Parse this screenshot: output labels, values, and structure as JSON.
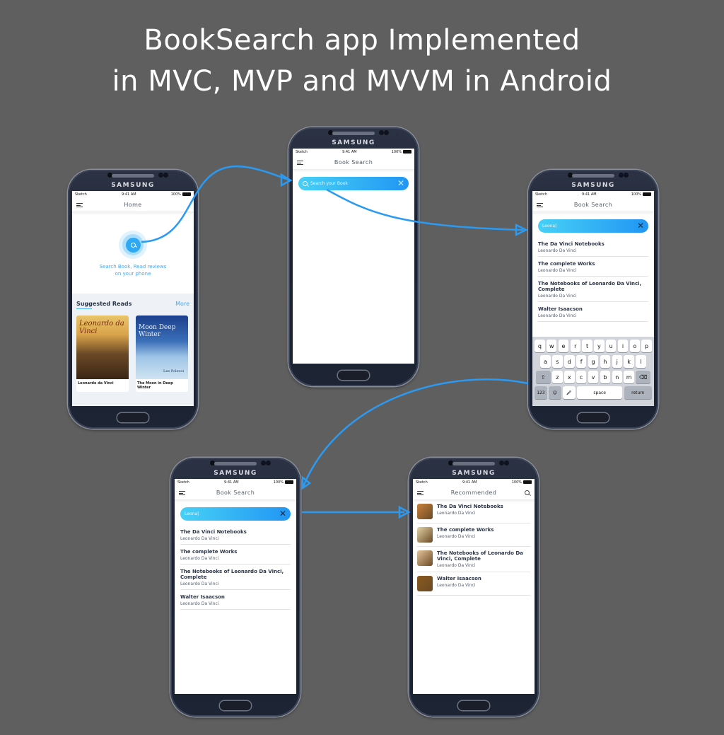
{
  "title_line1": "BookSearch app Implemented",
  "title_line2": "in MVC, MVP and MVVM in Android",
  "accent_color": "#2196f3",
  "phone_brand": "SAMSUNG",
  "status": {
    "carrier": "Sketch",
    "time": "9:41 AM",
    "battery": "100%"
  },
  "home": {
    "nav_title": "Home",
    "tagline_1": "Search Book, Read reviews",
    "tagline_2": "on your phone",
    "suggested_title": "Suggested Reads",
    "more_label": "More",
    "books": [
      {
        "title": "Leonarde da Vinci",
        "cover_text": "Leonardo da Vinci"
      },
      {
        "title": "The Moon in Deep Winter",
        "cover_text": "Moon Deep Winter",
        "cover_author": "Lee Polevoi"
      }
    ]
  },
  "search_empty": {
    "nav_title": "Book Search",
    "placeholder": "Search your Book"
  },
  "search_typed": {
    "nav_title": "Book Search",
    "query": "Leona",
    "results": [
      {
        "title": "The Da Vinci Notebooks",
        "author": "Leonardo Da Vinci"
      },
      {
        "title": "The complete Works",
        "author": "Leonardo Da Vinci"
      },
      {
        "title": "The Notebooks of Leonardo Da Vinci, Complete",
        "author": "Leonardo Da Vinci"
      },
      {
        "title": "Walter Isaacson",
        "author": "Leonardo Da Vinci"
      }
    ]
  },
  "keyboard": {
    "row1": [
      "q",
      "w",
      "e",
      "r",
      "t",
      "y",
      "u",
      "i",
      "o",
      "p"
    ],
    "row2": [
      "a",
      "s",
      "d",
      "f",
      "g",
      "h",
      "j",
      "k",
      "l"
    ],
    "row3": [
      "z",
      "x",
      "c",
      "v",
      "b",
      "n",
      "m"
    ],
    "num_label": "123",
    "space_label": "space",
    "return_label": "return",
    "shift_icon": "⇧",
    "delete_icon": "⌫",
    "emoji_icon": "☺",
    "mic_icon": "🎙"
  },
  "recommended": {
    "nav_title": "Recommended",
    "items": [
      {
        "title": "The Da Vinci Notebooks",
        "author": "Leonardo Da Vinci",
        "thumb_color": "#c9803a"
      },
      {
        "title": "The complete Works",
        "author": "Leonardo Da Vinci",
        "thumb_color": "#e3d3a6"
      },
      {
        "title": "The Notebooks of Leonardo Da Vinci, Complete",
        "author": "Leonardo Da Vinci",
        "thumb_color": "#e6c49a"
      },
      {
        "title": "Walter Isaacson",
        "author": "Leonardo Da Vinci",
        "thumb_color": "#8a5a1c"
      }
    ]
  }
}
